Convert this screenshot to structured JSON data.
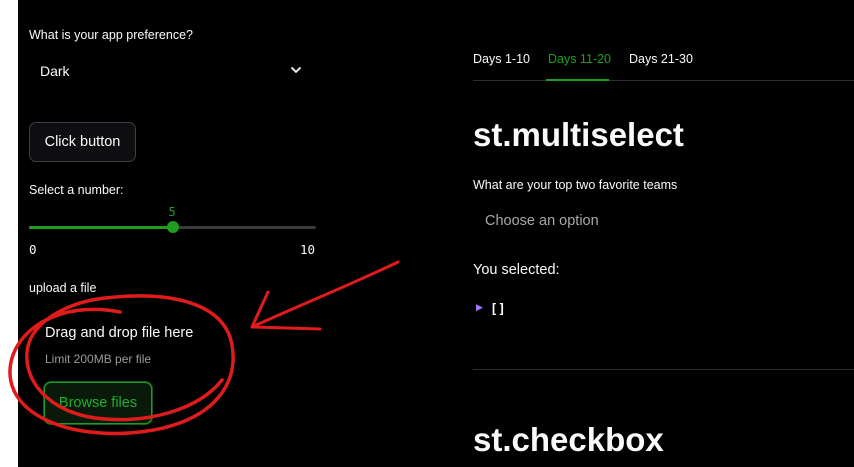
{
  "colors": {
    "accent": "#1f9d1f",
    "annotation": "#e01b1b",
    "background": "#000000",
    "text": "#fafafa"
  },
  "sidebar": {
    "preference_label": "What is your app preference?",
    "preference_value": "Dark",
    "button_label": "Click button",
    "slider": {
      "label": "Select a number:",
      "value": 5,
      "value_text": "5",
      "min": 0,
      "min_text": "0",
      "max": 10,
      "max_text": "10"
    },
    "uploader": {
      "label": "upload a file",
      "title": "Drag and drop file here",
      "limit": "Limit 200MB per file",
      "browse_label": "Browse files"
    }
  },
  "main": {
    "tabs": [
      {
        "label": "Days 1-10",
        "active": false
      },
      {
        "label": "Days 11-20",
        "active": true
      },
      {
        "label": "Days 21-30",
        "active": false
      }
    ],
    "multiselect": {
      "heading": "st.multiselect",
      "label": "What are your top two favorite teams",
      "placeholder": "Choose an option",
      "selected_label": "You selected:",
      "selected_value": "[]"
    },
    "checkbox_heading": "st.checkbox"
  },
  "icons": [
    "chevron-down-icon",
    "expand-caret-icon"
  ]
}
